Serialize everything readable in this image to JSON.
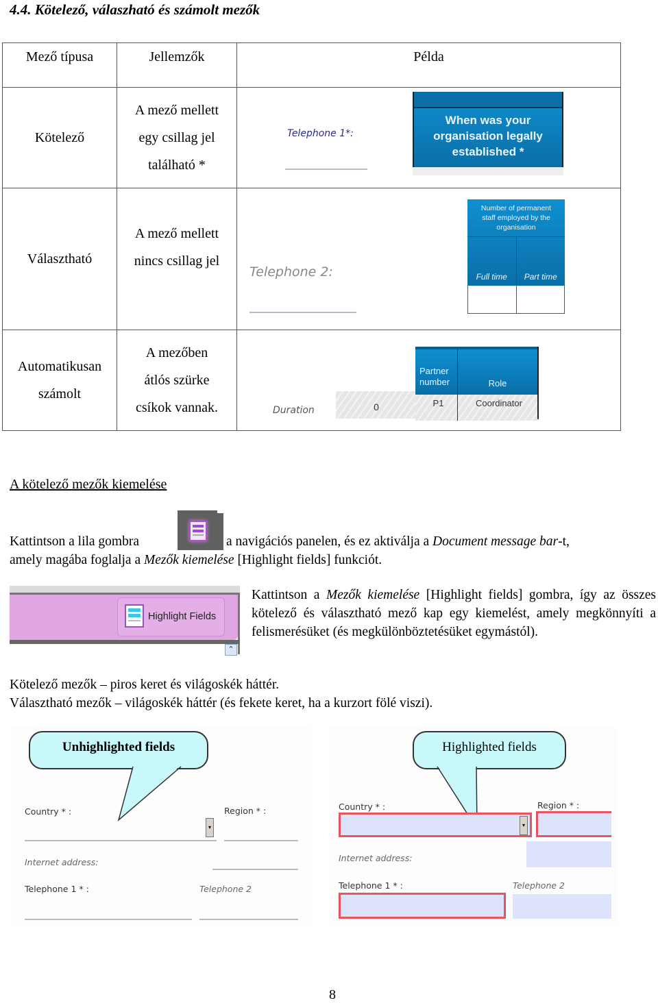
{
  "section_title": "4.4. Kötelező, válaszható és számolt mezők",
  "field_table": {
    "headers": [
      "Mező típusa",
      "Jellemzők",
      "Példa"
    ],
    "rows": [
      {
        "type": "Kötelező",
        "desc": [
          "A mező mellett",
          "egy csillag jel",
          "található *"
        ],
        "example": {
          "label": "Telephone 1*:",
          "header_text": [
            "When was your",
            "organisation legally",
            "established *"
          ]
        }
      },
      {
        "type": "Választható",
        "desc": [
          "A mező mellett",
          "nincs csillag jel"
        ],
        "example": {
          "label": "Telephone 2:",
          "header_text": [
            "Number of permanent",
            "staff employed by the",
            "organisation"
          ],
          "sub_headers": [
            "Full time",
            "Part time"
          ]
        }
      },
      {
        "type": [
          "Automatikusan",
          "számolt"
        ],
        "desc": [
          "A mezőben",
          "átlós szürke",
          "csíkok vannak."
        ],
        "example": {
          "label": "Duration",
          "value": "0",
          "headers": [
            "Partner number",
            "Role"
          ],
          "cells": [
            "P1",
            "Coordinator"
          ]
        }
      }
    ]
  },
  "highlight_heading": "A kötelező mezők kiemelése",
  "para1": {
    "part1": "Kattintson a lila gombra",
    "part2": "a navigációs panelen, és ez aktiválja a",
    "em1": "Document message bar",
    "part3": "-t,",
    "line2a": "amely magába foglalja a",
    "em2": "Mezők kiemelése",
    "line2b": "[Highlight fields] funkciót."
  },
  "highlight_bar": {
    "button_label": "Highlight Fields",
    "bar_color": "#dfa6e2"
  },
  "para2": {
    "a": "Kattintson a",
    "em": "Mezők kiemelése",
    "b": "[Highlight fields] gombra, így az összes kötelező és választható mező kap egy kiemelést, amely megkönnyíti a felismerésüket (és megkülönböztetésüket egymástól)."
  },
  "rule_required": "Kötelező mezők – piros keret és világoskék háttér.",
  "rule_optional": "Választható mezők – világoskék háttér (és fekete keret, ha a kurzort fölé viszi).",
  "comparison": {
    "unhighlighted": {
      "balloon": "Unhighlighted fields",
      "country": "Country * :",
      "region": "Region * :",
      "internet": "Internet address:",
      "tel1": "Telephone 1 * :",
      "tel2": "Telephone 2"
    },
    "highlighted": {
      "balloon": "Highlighted fields",
      "country": "Country * :",
      "region": "Region * :",
      "internet": "Internet address:",
      "tel1": "Telephone 1 * :",
      "tel2": "Telephone 2"
    },
    "colors": {
      "required_border": "#e85560",
      "field_bg": "#dce3fb",
      "balloon_bg": "#c8f8fa"
    }
  },
  "page_number": "8"
}
